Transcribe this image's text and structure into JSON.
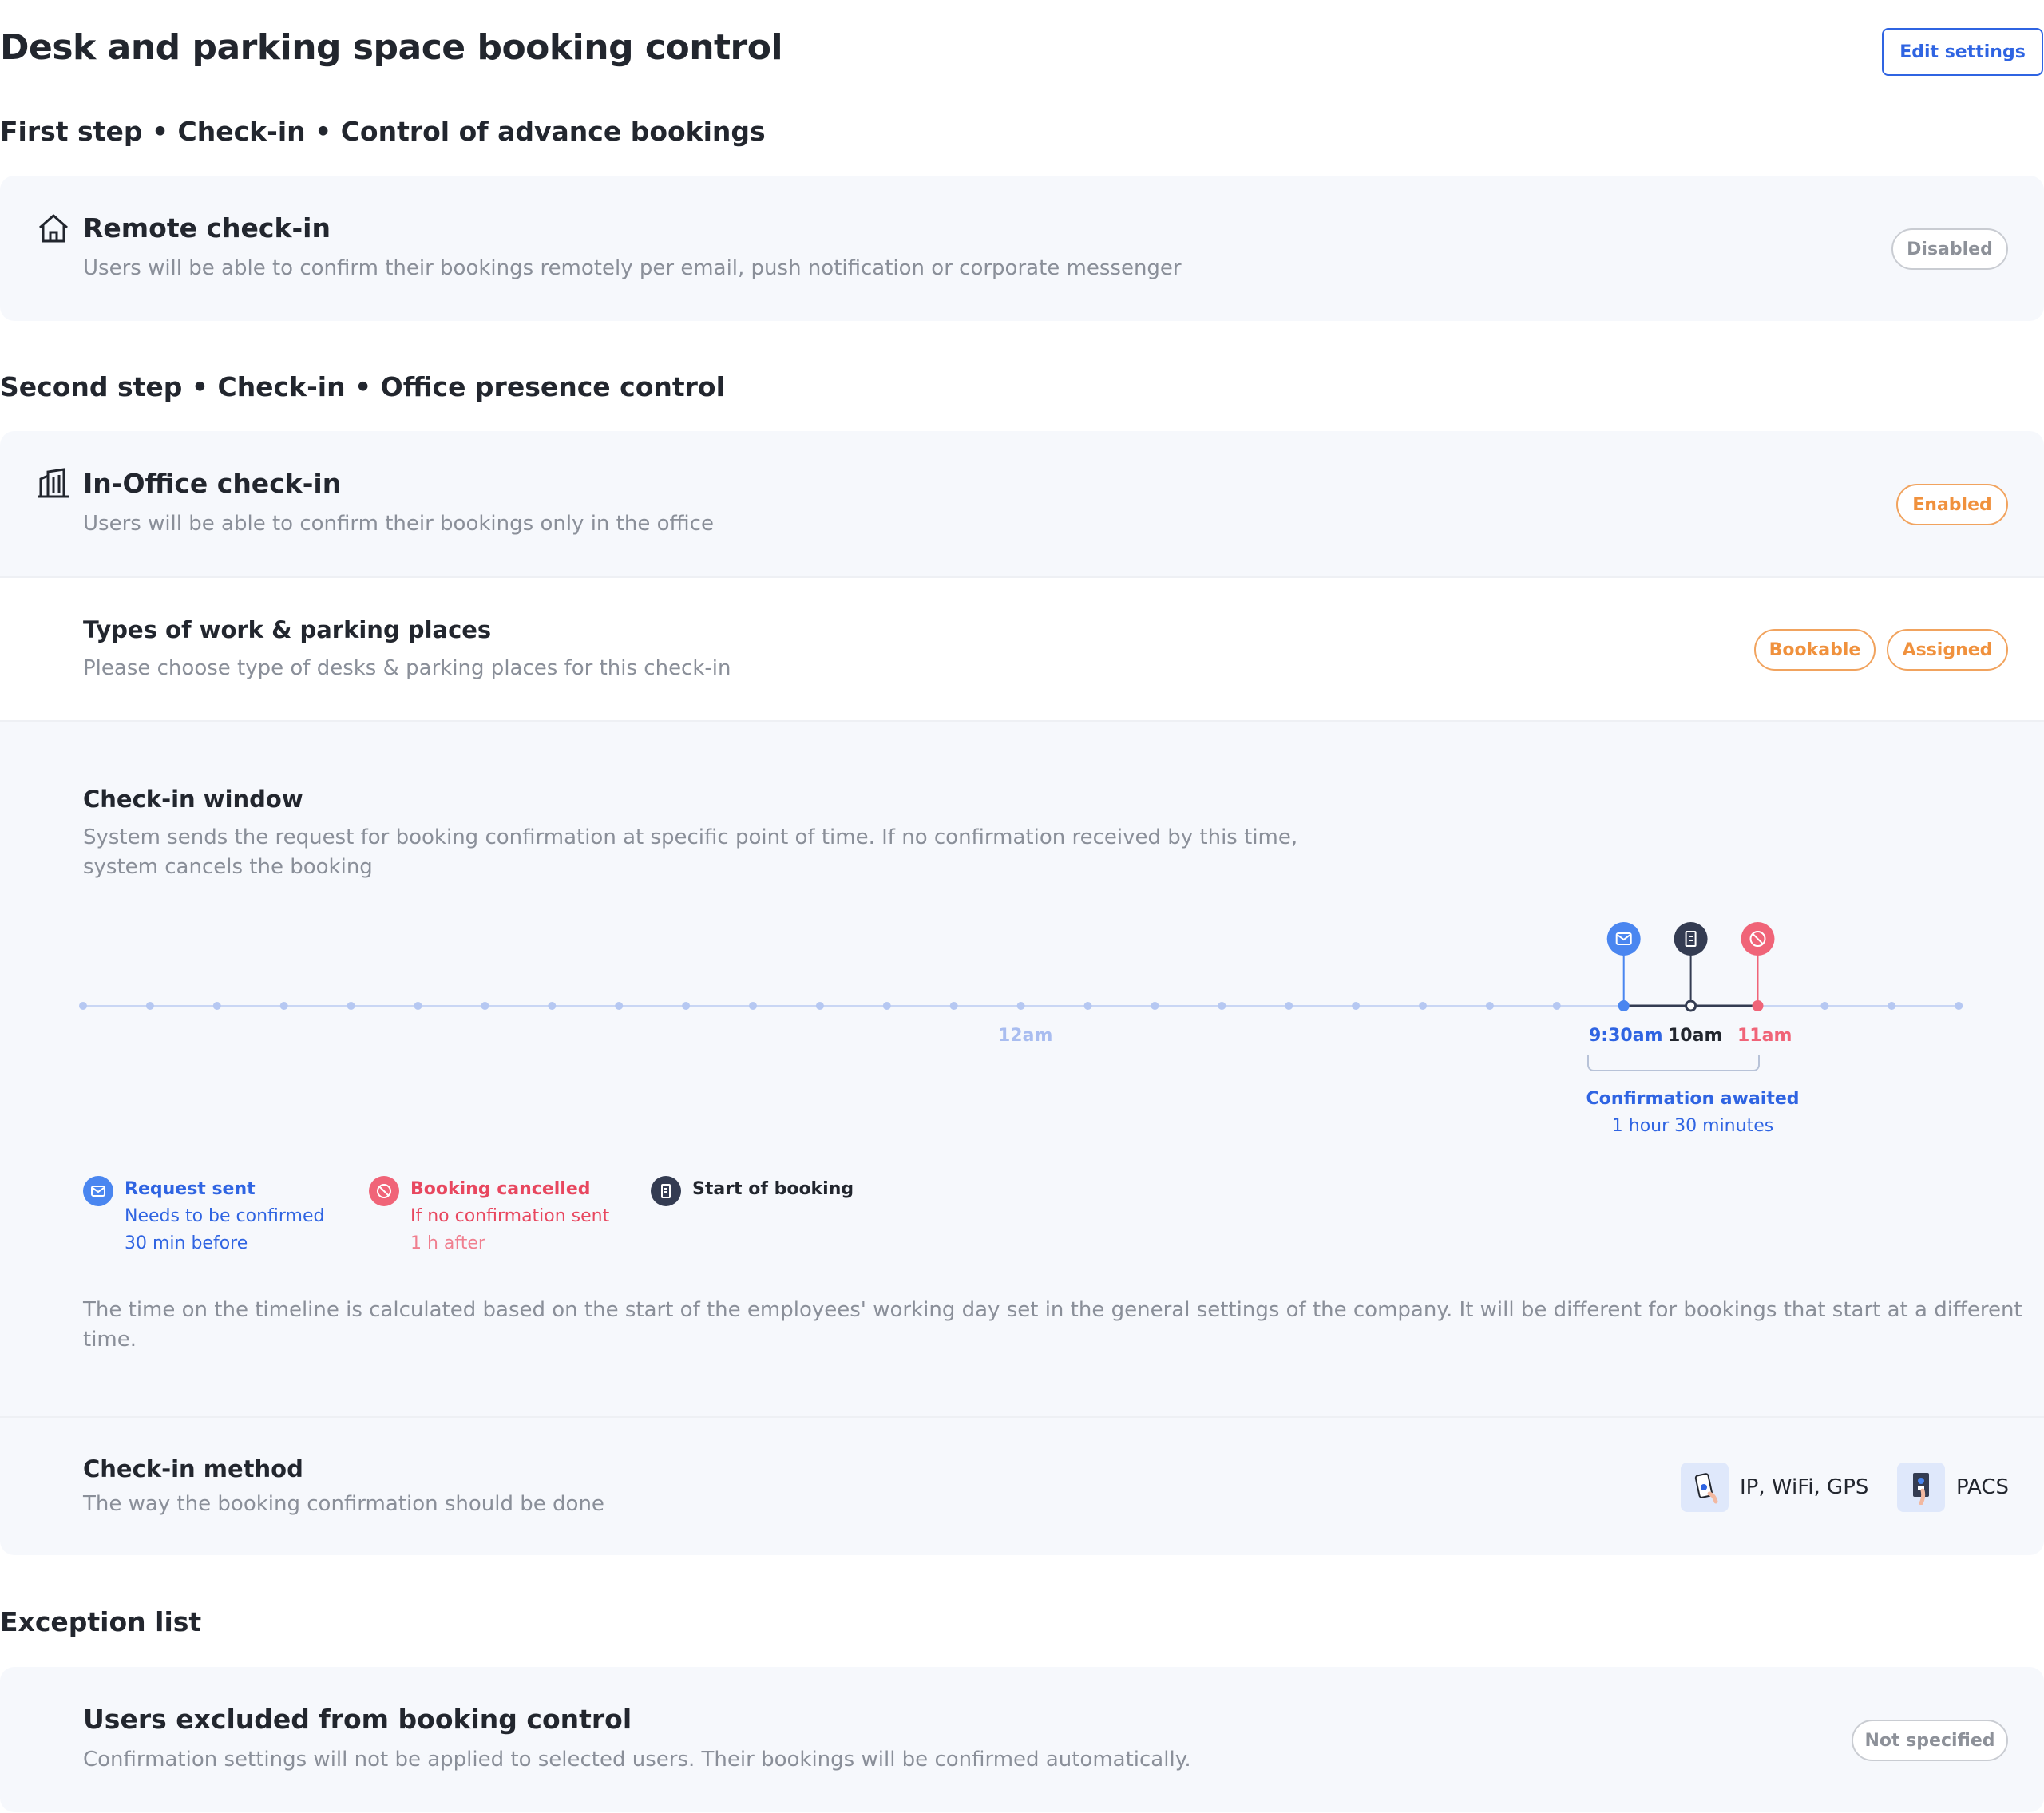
{
  "header": {
    "title": "Desk and parking space booking control",
    "edit_label": "Edit settings"
  },
  "sections": {
    "first": "First step • Check-in • Control of advance bookings",
    "second": "Second step • Check-in • Office presence control",
    "exceptions": "Exception list"
  },
  "remote": {
    "title": "Remote check-in",
    "subtitle": "Users will be able to confirm their bookings remotely per email, push notification or corporate messenger",
    "status": "Disabled"
  },
  "inoffice": {
    "title": "In-Office check-in",
    "subtitle": "Users will be able to confirm their bookings only in the office",
    "status": "Enabled"
  },
  "types": {
    "title": "Types of work & parking places",
    "subtitle": "Please choose type of desks & parking places for this check-in",
    "options": [
      "Bookable",
      "Assigned"
    ]
  },
  "window": {
    "title": "Check-in window",
    "subtitle_1": "System sends the request for booking confirmation at specific point of time. If no confirmation received by this time,",
    "subtitle_2": "system cancels the booking",
    "timeline": {
      "midnight_label": "12am",
      "request_time": "9:30am",
      "start_time": "10am",
      "cancel_time": "11am",
      "awaited_title": "Confirmation awaited",
      "awaited_duration": "1 hour 30 minutes"
    },
    "legend": {
      "request_title": "Request sent",
      "request_line1": "Needs to be confirmed",
      "request_line2": "30 min before",
      "cancel_title": "Booking cancelled",
      "cancel_line1": "If no confirmation sent",
      "cancel_line2": "1 h after",
      "start_title": "Start of booking"
    },
    "note_1": "The time on the timeline is calculated based on the start of the employees' working day set in the general settings of the company. It will be different for bookings that start at a different",
    "note_2": "time."
  },
  "method": {
    "title": "Check-in method",
    "subtitle": "The way the booking confirmation should be done",
    "options": [
      "IP, WiFi, GPS",
      "PACS"
    ]
  },
  "excluded": {
    "title": "Users excluded from booking control",
    "subtitle": "Confirmation settings will not be applied to selected users. Their bookings will be confirmed automatically.",
    "status": "Not specified"
  },
  "colors": {
    "blue": "#2f64e2",
    "request": "#4a86f0",
    "cancel": "#f06478",
    "start": "#343c52",
    "orange": "#f0913d"
  }
}
